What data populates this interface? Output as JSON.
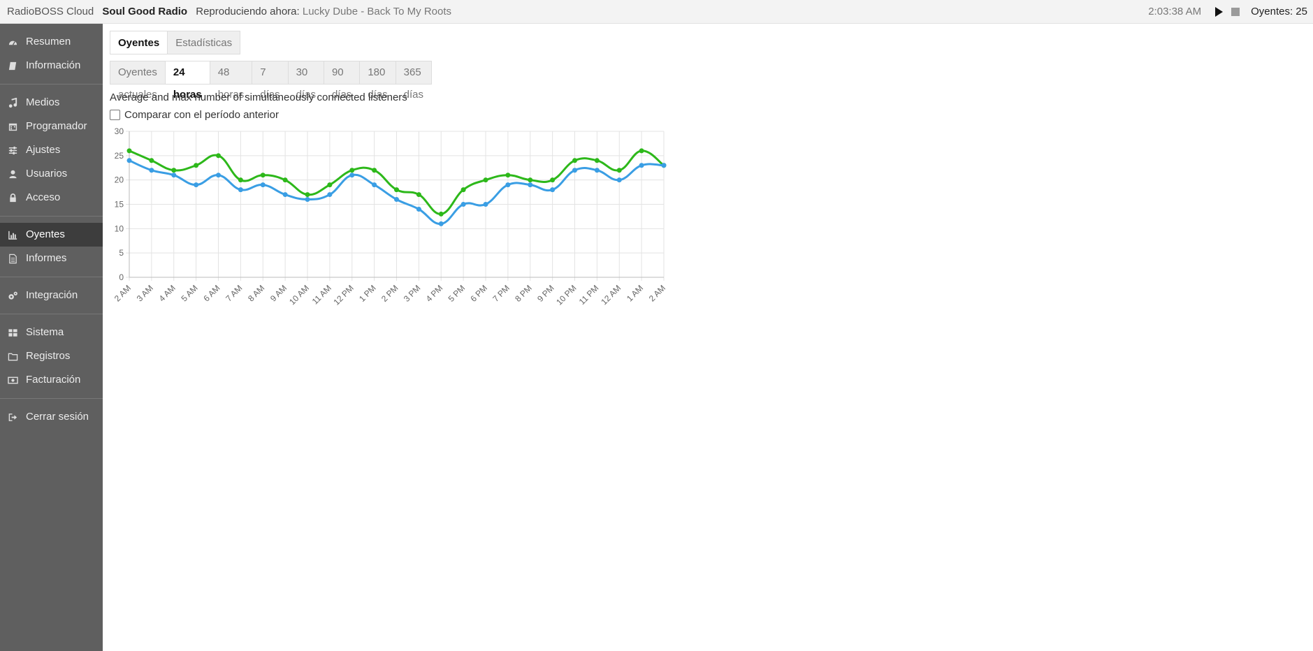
{
  "topbar": {
    "app_name": "RadioBOSS Cloud",
    "station_name": "Soul Good Radio",
    "now_playing_label": "Reproduciendo ahora:",
    "now_playing_track": "Lucky Dube - Back To My Roots",
    "time": "2:03:38 AM",
    "listeners": "Oyentes: 25"
  },
  "sidebar": {
    "groups": [
      [
        {
          "label": "Resumen",
          "icon": "dashboard-icon"
        },
        {
          "label": "Información",
          "icon": "book-icon"
        }
      ],
      [
        {
          "label": "Medios",
          "icon": "music-icon"
        },
        {
          "label": "Programador",
          "icon": "calendar-icon"
        },
        {
          "label": "Ajustes",
          "icon": "sliders-icon"
        },
        {
          "label": "Usuarios",
          "icon": "user-icon"
        },
        {
          "label": "Acceso",
          "icon": "lock-icon"
        }
      ],
      [
        {
          "label": "Oyentes",
          "icon": "bar-chart-icon",
          "active": true
        },
        {
          "label": "Informes",
          "icon": "document-icon"
        }
      ],
      [
        {
          "label": "Integración",
          "icon": "cogs-icon"
        }
      ],
      [
        {
          "label": "Sistema",
          "icon": "grid-icon"
        },
        {
          "label": "Registros",
          "icon": "folder-icon"
        },
        {
          "label": "Facturación",
          "icon": "money-icon"
        }
      ],
      [
        {
          "label": "Cerrar sesión",
          "icon": "sign-out-icon"
        }
      ]
    ]
  },
  "tabs": [
    {
      "label": "Oyentes",
      "active": true
    },
    {
      "label": "Estadísticas",
      "active": false
    }
  ],
  "periods": [
    {
      "label": "Oyentes actuales",
      "active": false
    },
    {
      "label": "24 horas",
      "active": true
    },
    {
      "label": "48 horas",
      "active": false
    },
    {
      "label": "7 días",
      "active": false
    },
    {
      "label": "30 días",
      "active": false
    },
    {
      "label": "90 días",
      "active": false
    },
    {
      "label": "180 días",
      "active": false
    },
    {
      "label": "365 días",
      "active": false
    }
  ],
  "description": "Average and max number of simultaneously connected listeners",
  "compare_label": "Comparar con el período anterior",
  "compare_checked": false,
  "chart_data": {
    "type": "line",
    "x": [
      "2 AM",
      "3 AM",
      "4 AM",
      "5 AM",
      "6 AM",
      "7 AM",
      "8 AM",
      "9 AM",
      "10 AM",
      "11 AM",
      "12 PM",
      "1 PM",
      "2 PM",
      "3 PM",
      "4 PM",
      "5 PM",
      "6 PM",
      "7 PM",
      "8 PM",
      "9 PM",
      "10 PM",
      "11 PM",
      "12 AM",
      "1 AM",
      "2 AM"
    ],
    "yticks": [
      0,
      5,
      10,
      15,
      20,
      25,
      30
    ],
    "ylim": [
      0,
      30
    ],
    "grid": true,
    "series": [
      {
        "color": "#2db81a",
        "values": [
          26,
          24,
          22,
          23,
          25,
          20,
          21,
          20,
          17,
          19,
          22,
          22,
          18,
          17,
          13,
          18,
          20,
          21,
          20,
          20,
          24,
          24,
          22,
          26,
          23
        ]
      },
      {
        "color": "#3a9ee4",
        "values": [
          24,
          22,
          21,
          19,
          21,
          18,
          19,
          17,
          16,
          17,
          21,
          19,
          16,
          14,
          11,
          15,
          15,
          19,
          19,
          18,
          22,
          22,
          20,
          23,
          23
        ]
      }
    ]
  }
}
